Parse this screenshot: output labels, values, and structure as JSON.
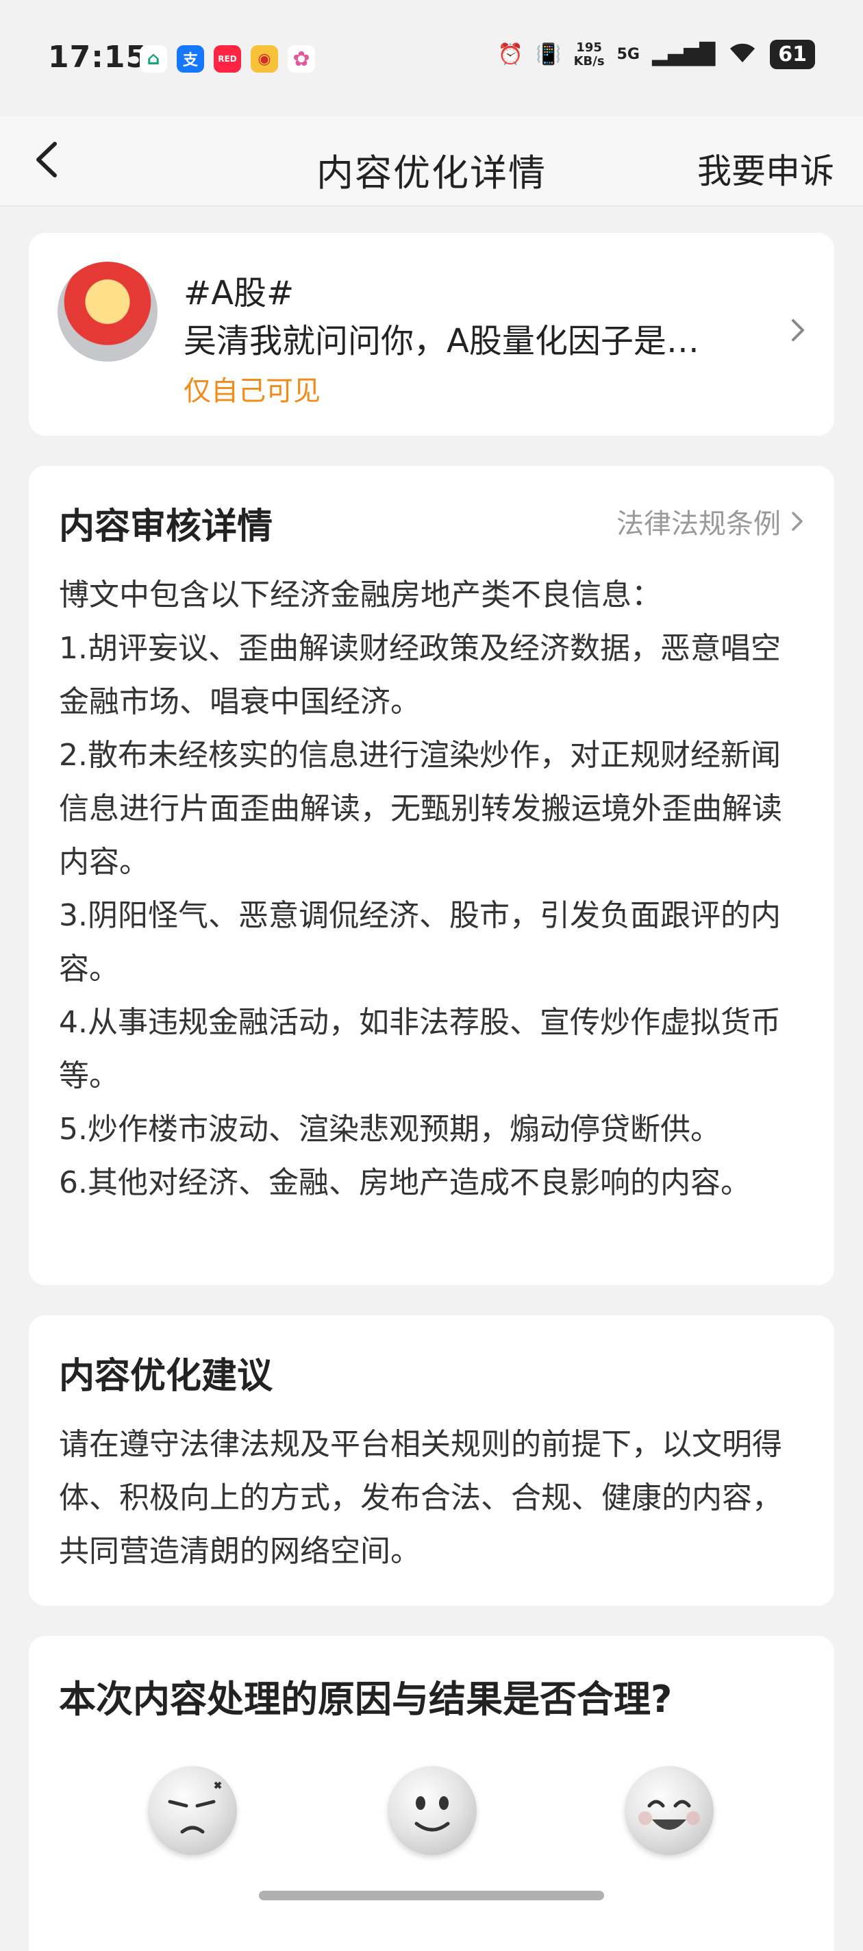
{
  "status_bar": {
    "time": "17:15",
    "speed_value": "195",
    "speed_unit": "KB/s",
    "network": "5G",
    "battery": "61"
  },
  "header": {
    "title": "内容优化详情",
    "appeal_label": "我要申诉"
  },
  "post": {
    "hashtag": "#A股#",
    "text": "吴清我就问问你，A股量化因子是…",
    "visibility": "仅自己可见"
  },
  "review": {
    "title": "内容审核详情",
    "law_link": "法律法规条例",
    "intro": "博文中包含以下经济金融房地产类不良信息：",
    "items": [
      "1.胡评妄议、歪曲解读财经政策及经济数据，恶意唱空金融市场、唱衰中国经济。",
      "2.散布未经核实的信息进行渲染炒作，对正规财经新闻信息进行片面歪曲解读，无甄别转发搬运境外歪曲解读内容。",
      "3.阴阳怪气、恶意调侃经济、股市，引发负面跟评的内容。",
      "4.从事违规金融活动，如非法荐股、宣传炒作虚拟货币等。",
      "5.炒作楼市波动、渲染悲观预期，煽动停贷断供。",
      "6.其他对经济、金融、房地产造成不良影响的内容。"
    ]
  },
  "suggestion": {
    "title": "内容优化建议",
    "body": "请在遵守法律法规及平台相关规则的前提下，以文明得体、积极向上的方式，发布合法、合规、健康的内容，共同营造清朗的网络空间。"
  },
  "feedback": {
    "question": "本次内容处理的原因与结果是否合理?"
  },
  "colors": {
    "accent_orange": "#f08c1a",
    "background": "#f2f2f2",
    "card": "#ffffff"
  }
}
